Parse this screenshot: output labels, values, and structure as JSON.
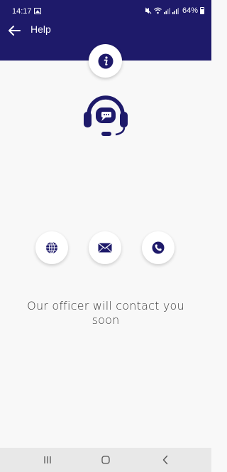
{
  "status_bar": {
    "time": "14:17",
    "battery": "64%"
  },
  "app_bar": {
    "title": "Help"
  },
  "main": {
    "message": "Our officer will contact you soon"
  },
  "actions": [
    {
      "icon": "globe-icon"
    },
    {
      "icon": "mail-icon"
    },
    {
      "icon": "phone-icon"
    }
  ],
  "colors": {
    "primary": "#1e1a6a",
    "background": "#f8f8f8"
  }
}
